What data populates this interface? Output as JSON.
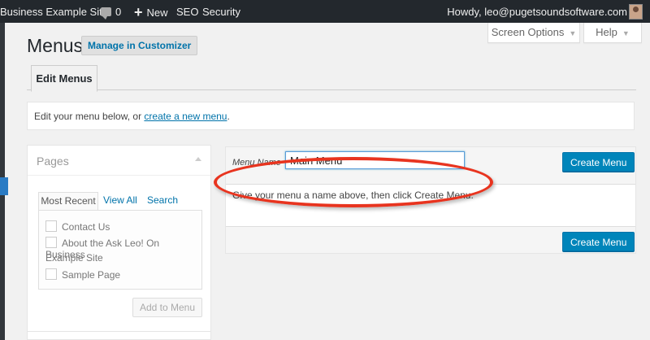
{
  "admin_bar": {
    "site_name": "Business Example Site",
    "comments_count": "0",
    "new_label": "New",
    "seo_label": "SEO",
    "security_label": "Security",
    "howdy": "Howdy, leo@pugetsoundsoftware.com"
  },
  "screen_meta": {
    "screen_options": "Screen Options",
    "help": "Help"
  },
  "page": {
    "title": "Menus",
    "manage_customizer": "Manage in Customizer",
    "tab_edit_menus": "Edit Menus"
  },
  "notice": {
    "prefix": "Edit your menu below, or ",
    "link": "create a new menu",
    "suffix": "."
  },
  "pages_box": {
    "title": "Pages",
    "tabs": [
      "Most Recent",
      "View All",
      "Search"
    ],
    "items": [
      "Contact Us",
      "About the Ask Leo! On Business",
      "Example Site",
      "Sample Page"
    ],
    "add_button": "Add to Menu"
  },
  "menu_editor": {
    "name_label": "Menu Name",
    "name_value": "Main Menu",
    "create_top": "Create Menu",
    "create_bottom": "Create Menu",
    "instructions": "Give your menu a name above, then click Create Menu."
  },
  "colors": {
    "admin_bar_bg": "#23282d",
    "primary_button": "#0085ba",
    "link": "#0073aa",
    "highlight": "#e8341f"
  }
}
